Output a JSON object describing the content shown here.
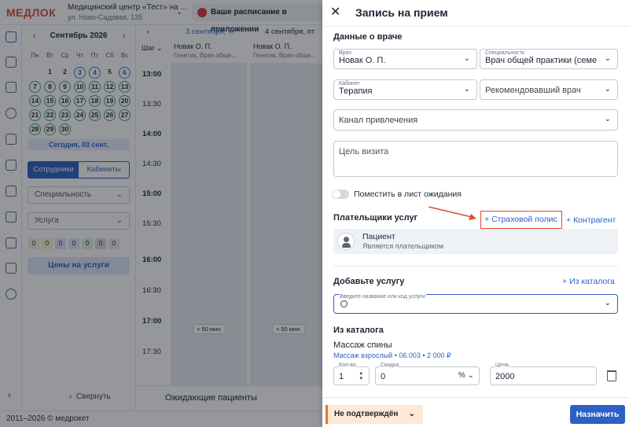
{
  "header": {
    "logo": "МЕДЛОК",
    "clinic_name": "Медицинский центр «Тест» на ...",
    "clinic_address": "ул. Ново-Садовая, 135",
    "schedule_app_label": "Ваше расписание в приложении"
  },
  "calendar": {
    "month_label": "Сентябрь 2026",
    "weekdays": [
      "Пн",
      "Вт",
      "Ср",
      "Чт",
      "Пт",
      "Сб",
      "Вс"
    ],
    "today_label": "Сегодня, 03 сент.",
    "tab_staff": "Сотрудники",
    "tab_rooms": "Кабинеты",
    "specialty_placeholder": "Специальность",
    "service_placeholder": "Услуга",
    "counts": [
      "0",
      "0",
      "0",
      "0",
      "0",
      "0",
      "0"
    ],
    "prices_label": "Цены на услуги",
    "collapse_label": "Свернуть"
  },
  "schedule": {
    "step_label": "Шаг",
    "col1_date": "3 сентября, чт",
    "col2_date": "4 сентября, пт",
    "doctor_name": "Новак О. П.",
    "doctor_spec": "Генетик, Врач обще...",
    "times": [
      "13:00",
      "13:30",
      "14:00",
      "14:30",
      "15:00",
      "15:30",
      "16:00",
      "16:30",
      "17:00",
      "17:30"
    ],
    "plus_label": "+ 50 мин.",
    "waiting_label": "Ожидающие пациенты"
  },
  "footer": {
    "copyright": "2011–2026 © медрокет"
  },
  "modal": {
    "title": "Запись на прием",
    "doctor_section": "Данные о враче",
    "doctor_label": "Врач",
    "doctor_value": "Новак О. П.",
    "specialty_label": "Специальность",
    "specialty_value": "Врач общей практики (семе",
    "room_label": "Кабинет",
    "room_value": "Терапия",
    "referrer_placeholder": "Рекомендовавший врач",
    "channel_placeholder": "Канал привлечения",
    "purpose_placeholder": "Цель визита",
    "waitlist_label": "Поместить в лист ожидания",
    "payers_section": "Плательщики услуг",
    "insurance_button": "Страховой полис",
    "contractor_button": "Контрагент",
    "payer_name": "Пациент",
    "payer_desc": "Является плательщиком",
    "add_service_section": "Добавьте услугу",
    "from_catalog_link": "Из каталога",
    "search_label": "Введите название или код услуги",
    "catalog_section": "Из каталога",
    "service_name": "Массаж спины",
    "service_desc": "Массаж взрослый • 06.003 • 2 000 ₽",
    "qty_label": "Кол-во",
    "qty_value": "1",
    "discount_label": "Скидка",
    "discount_value": "0",
    "discount_unit": "%",
    "price_label": "Цена",
    "price_value": "2000",
    "status_label": "Не подтверждён",
    "submit_label": "Назначить"
  },
  "colors": {
    "accent": "#2d5fc4",
    "highlight": "#e14b32",
    "status": "#e8731d"
  }
}
